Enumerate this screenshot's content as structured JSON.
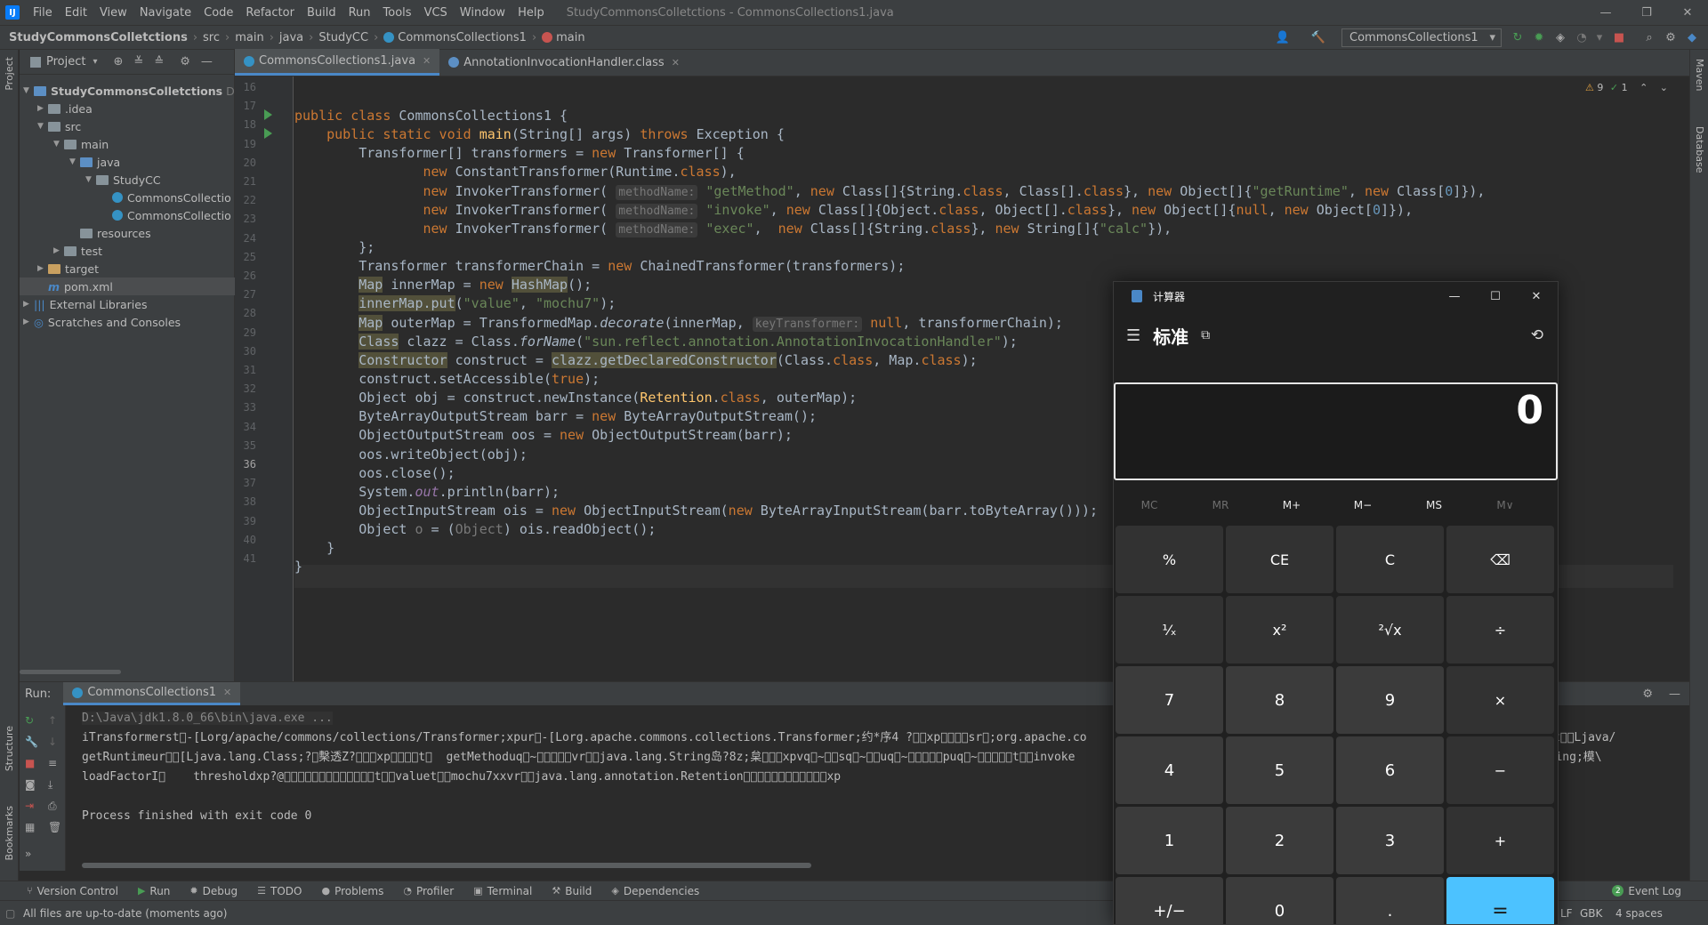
{
  "menubar": {
    "items": [
      "File",
      "Edit",
      "View",
      "Navigate",
      "Code",
      "Refactor",
      "Build",
      "Run",
      "Tools",
      "VCS",
      "Window",
      "Help"
    ],
    "window_title": "StudyCommonsColletctions - CommonsCollections1.java"
  },
  "navbar": {
    "crumbs": [
      "StudyCommonsColletctions",
      "src",
      "main",
      "java",
      "StudyCC",
      "CommonsCollections1",
      "main"
    ],
    "run_config": "CommonsCollections1"
  },
  "left_stripe": {
    "project": "Project",
    "structure": "Structure",
    "bookmarks": "Bookmarks"
  },
  "right_stripe": {
    "maven": "Maven",
    "database": "Database"
  },
  "project_panel": {
    "title": "Project",
    "tree": [
      {
        "label": "StudyCommonsColletctions",
        "suffix": "D:\\",
        "depth": 0
      },
      {
        "label": ".idea",
        "depth": 1
      },
      {
        "label": "src",
        "depth": 1
      },
      {
        "label": "main",
        "depth": 2
      },
      {
        "label": "java",
        "depth": 3
      },
      {
        "label": "StudyCC",
        "depth": 4
      },
      {
        "label": "CommonsCollectio",
        "depth": 5
      },
      {
        "label": "CommonsCollectio",
        "depth": 5
      },
      {
        "label": "resources",
        "depth": 3
      },
      {
        "label": "test",
        "depth": 2
      },
      {
        "label": "target",
        "depth": 1
      },
      {
        "label": "pom.xml",
        "depth": 1
      },
      {
        "label": "External Libraries",
        "depth": 0
      },
      {
        "label": "Scratches and Consoles",
        "depth": 0
      }
    ]
  },
  "editor": {
    "tabs": [
      "CommonsCollections1.java",
      "AnnotationInvocationHandler.class"
    ],
    "inspections": {
      "warnings": "9",
      "checks": "1"
    },
    "line_numbers": [
      "16",
      "17",
      "18",
      "19",
      "20",
      "21",
      "22",
      "23",
      "24",
      "25",
      "26",
      "27",
      "28",
      "29",
      "30",
      "31",
      "32",
      "33",
      "34",
      "35",
      "36",
      "37",
      "38",
      "39",
      "40",
      "41"
    ],
    "current_line": "36"
  },
  "run_panel": {
    "label": "Run:",
    "tab": "CommonsCollections1",
    "console": [
      "D:\\Java\\jdk1.8.0_66\\bin\\java.exe ...",
      "iTransformerst\u0000-[Lorg/apache/commons/collections/Transformer;xpur\u0000-[Lorg.apache.commons.collections.Transformer;约*序4 ?\u0000\u0000xp\u0000\u0000\u0000\u0000sr\u0000;org.apache.co                                                          iConstantt\u0000\u0000Ljava/",
      "getRuntimeur\u0000\u0000[Ljava.lang.Class;?\u0000檕透Z?\u0000\u0000\u0000xp\u0000\u0000\u0000\u0000t\u0000  getMethoduq\u0000~\u0000\u0000\u0000\u0000\u0000vr\u0000\u0000java.lang.String岛?8z;枲\u0000\u0000\u0000xpvq\u0000~\u0000\u0000sq\u0000~\u0000\u0000uq\u0000~\u0000\u0000\u0000\u0000\u0000puq\u0000~\u0000\u0000\u0000\u0000\u0000t\u0000\u0000invoke                                                         ava.lang.String;模\\",
      "loadFactorI\u0000    thresholdxp?@\u0000\u0000\u0000\u0000\u0000\u0000\u0000\u0000\u0000\u0000\u0000\u0000\u0000t\u0000\u0000valuet\u0000\u0000mochu7xxvr\u0000\u0000java.lang.annotation.Retention\u0000\u0000\u0000\u0000\u0000\u0000\u0000\u0000\u0000\u0000\u0000\u0000xp",
      "",
      "Process finished with exit code 0"
    ]
  },
  "bottom_tabs": [
    "Version Control",
    "Run",
    "Debug",
    "TODO",
    "Problems",
    "Profiler",
    "Terminal",
    "Build",
    "Dependencies"
  ],
  "event_log": {
    "count": "2",
    "label": "Event Log"
  },
  "status": {
    "message": "All files are up-to-date (moments ago)",
    "encoding": "GBK",
    "indent": "4 spaces",
    "right_tail": "LF"
  },
  "calculator": {
    "title": "计算器",
    "mode": "标准",
    "display": "0",
    "memory": [
      "MC",
      "MR",
      "M+",
      "M−",
      "MS",
      "M∨"
    ],
    "keys": [
      "%",
      "CE",
      "C",
      "⌫",
      "¹⁄ₓ",
      "x²",
      "²√x",
      "÷",
      "7",
      "8",
      "9",
      "×",
      "4",
      "5",
      "6",
      "−",
      "1",
      "2",
      "3",
      "+",
      "+/−",
      "0",
      ".",
      "="
    ]
  },
  "colors": {
    "ide_bg": "#2b2b2b",
    "panel": "#3c3f41",
    "keyword": "#cc7832",
    "string": "#6a8759",
    "accent": "#4cc2ff"
  }
}
